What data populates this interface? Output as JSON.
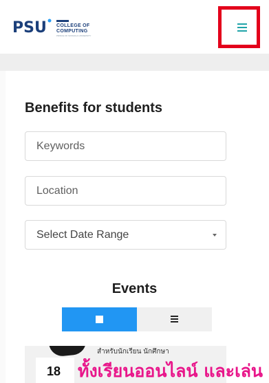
{
  "header": {
    "logo": {
      "mark_text": "PSU",
      "line1": "COLLEGE OF",
      "line2": "COMPUTING",
      "line3": "PRINCE OF SONGKLA UNIVERSITY"
    },
    "menu_icon": "hamburger-icon"
  },
  "colors": {
    "logo_blue": "#1b3f7a",
    "menu_teal": "#1fa3a8",
    "highlight_red": "#e3001b",
    "toggle_blue": "#2196f3",
    "banner_pink": "#e8168a"
  },
  "main": {
    "title": "Benefits for students",
    "keywords_placeholder": "Keywords",
    "location_placeholder": "Location",
    "date_range_label": "Select Date Range",
    "events_title": "Events",
    "view_toggle": {
      "grid_icon": "grid-view-icon",
      "list_icon": "list-view-icon"
    }
  },
  "event_banner": {
    "day": "18",
    "small_text": "สำหรับนักเรียน นักศึกษา",
    "headline": "ทั้งเรียนออนไลน์ และเล่น"
  }
}
